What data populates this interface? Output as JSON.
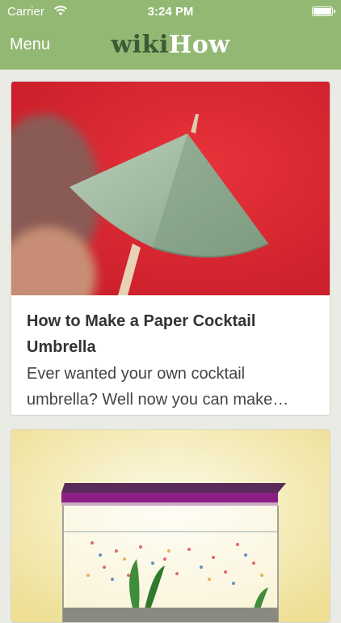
{
  "status": {
    "carrier": "Carrier",
    "time": "3:24 PM"
  },
  "nav": {
    "menu_label": "Menu",
    "logo_part1": "wiki",
    "logo_part2": "How"
  },
  "articles": [
    {
      "title": "How to Make a Paper Cocktail Umbrella",
      "description": "Ever wanted your own cocktail umbrella? Well now you can make…",
      "image": "paper-cocktail-umbrella-photo"
    },
    {
      "image": "aquarium-illustration"
    }
  ],
  "colors": {
    "nav_bg": "#93b874",
    "logo_wiki": "#3c5a34",
    "background": "#ebebe6"
  }
}
